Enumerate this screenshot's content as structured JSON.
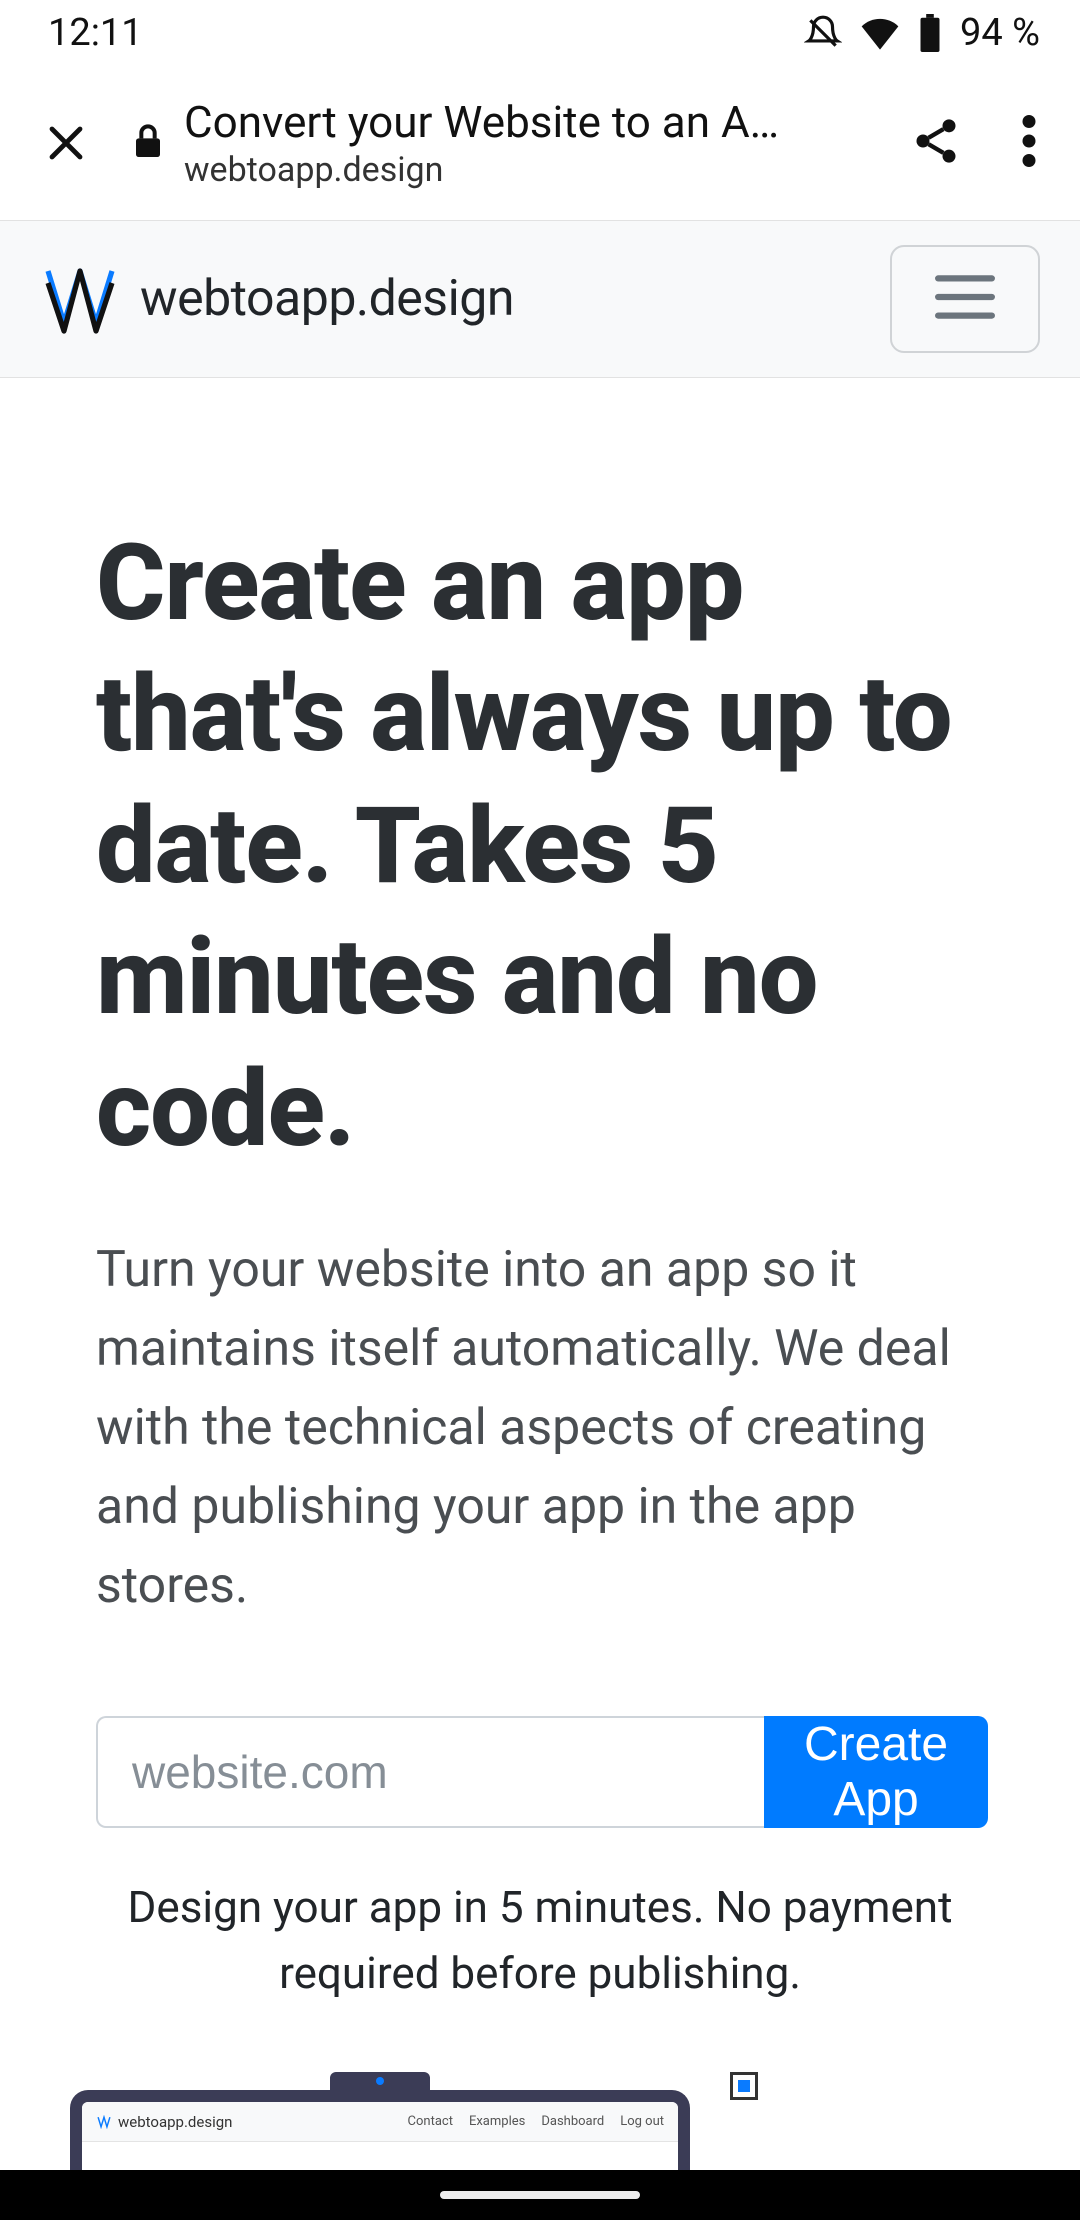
{
  "status": {
    "time": "12:11",
    "battery": "94 %"
  },
  "chrome": {
    "title": "Convert your Website to an A…",
    "host": "webtoapp.design"
  },
  "nav": {
    "brand": "webtoapp.design"
  },
  "hero": {
    "headline": "Create an app that's always up to date. Takes 5 minutes and no code.",
    "sub": "Turn your website into an app so it maintains itself automatically. We deal with the technical aspects of creating and publishing your app in the app stores.",
    "placeholder": "website.com",
    "cta": "Create App",
    "note": "Design your app in 5 minutes. No payment required before publishing."
  },
  "illus": {
    "brand": "webtoapp.design",
    "links": [
      "Contact",
      "Examples",
      "Dashboard",
      "Log out"
    ]
  }
}
